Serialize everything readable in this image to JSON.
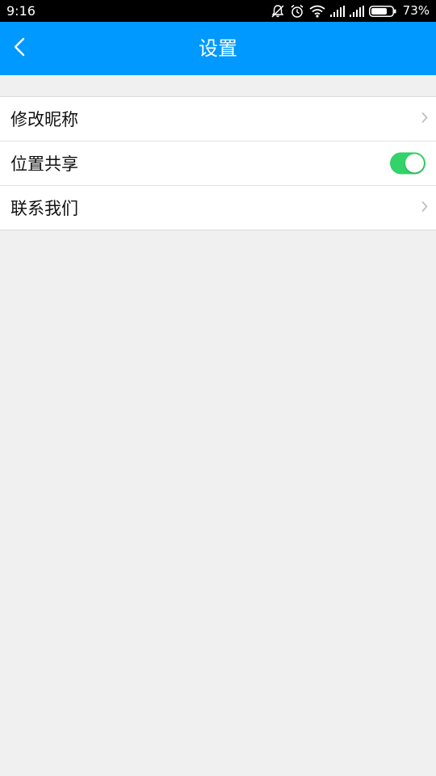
{
  "status_bar": {
    "time": "9:16",
    "battery_percent": "73%",
    "icons": [
      "mute-icon",
      "alarm-icon",
      "wifi-icon",
      "signal-icon",
      "signal-icon",
      "battery-icon"
    ]
  },
  "app_bar": {
    "title": "设置",
    "back_icon": "chevron-left-icon",
    "background_color": "#0099ff"
  },
  "settings": {
    "items": [
      {
        "label": "修改昵称",
        "control": "chevron-right-icon"
      },
      {
        "label": "位置共享",
        "control": "toggle",
        "toggle_on": true,
        "toggle_color": "#33d26a"
      },
      {
        "label": "联系我们",
        "control": "chevron-right-icon"
      }
    ]
  }
}
